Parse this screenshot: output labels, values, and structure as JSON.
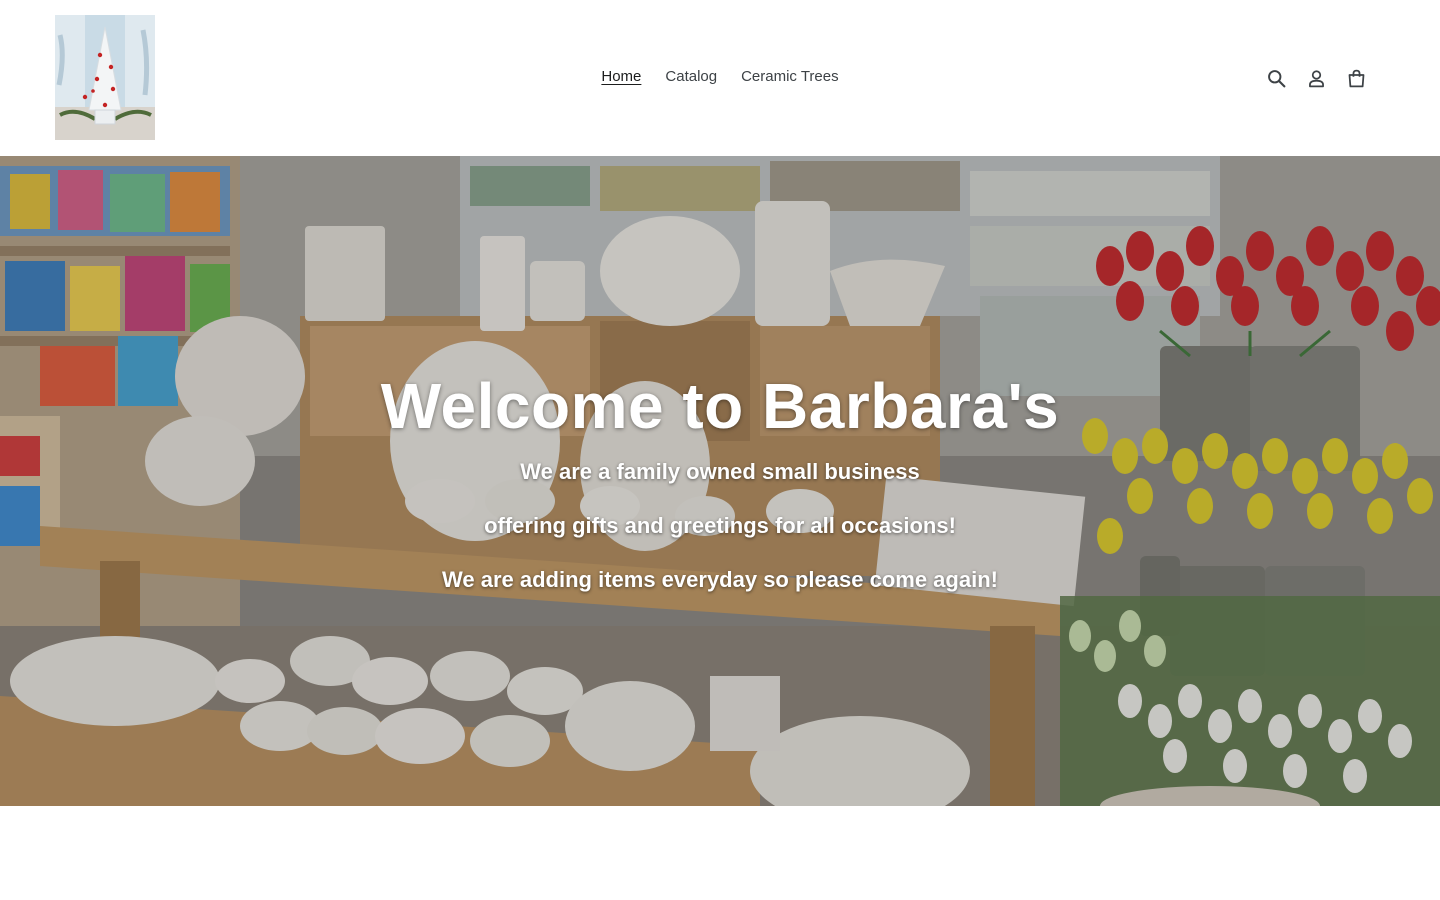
{
  "header": {
    "logo_alt": "Barbara's ceramic tree logo",
    "nav": [
      {
        "label": "Home",
        "active": true
      },
      {
        "label": "Catalog",
        "active": false
      },
      {
        "label": "Ceramic Trees",
        "active": false
      }
    ],
    "icons": [
      "search-icon",
      "account-icon",
      "cart-icon"
    ]
  },
  "hero": {
    "title": "Welcome to Barbara's",
    "lines": [
      "We are a family owned small business",
      "offering gifts and greetings for all occasions!",
      "We are adding items everyday so please come again!"
    ]
  },
  "colors": {
    "text": "#3d4246",
    "hero_text": "#ffffff",
    "background": "#ffffff"
  }
}
